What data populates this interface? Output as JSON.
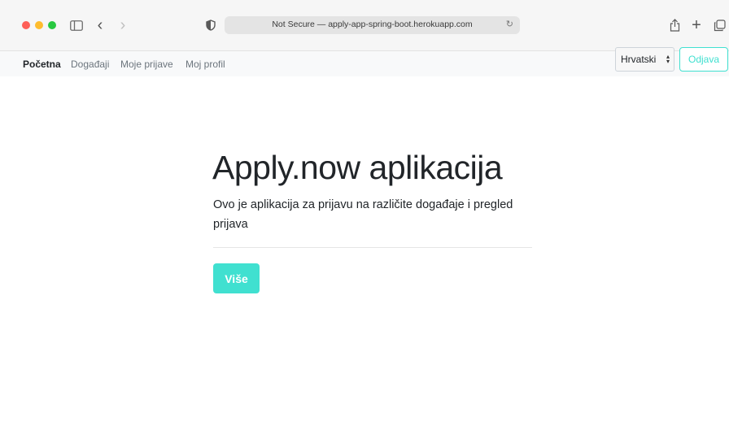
{
  "browser": {
    "address": "Not Secure — apply-app-spring-boot.herokuapp.com",
    "icons": {
      "sidebar": "sidebar-icon",
      "back": "chevron-left-icon",
      "forward": "chevron-right-icon",
      "privacy": "shield-icon",
      "reload": "reload-icon",
      "share": "share-icon",
      "new_tab": "plus-icon",
      "tabs": "tab-overview-icon"
    }
  },
  "navbar": {
    "items": [
      {
        "label": "Početna",
        "active": true
      },
      {
        "label": "Događaji",
        "active": false
      },
      {
        "label": "Moje prijave",
        "active": false
      },
      {
        "label": "Moj profil",
        "active": false
      }
    ],
    "language": "Hrvatski",
    "logout_label": "Odjava"
  },
  "hero": {
    "title": "Apply.now aplikacija",
    "lead": "Ovo je aplikacija za prijavu na različite događaje i pregled prijava",
    "button_label": "Više"
  },
  "colors": {
    "accent": "#40e0d0",
    "navbar_bg": "#f8f9fa",
    "text": "#212529",
    "muted": "#6c757d"
  }
}
